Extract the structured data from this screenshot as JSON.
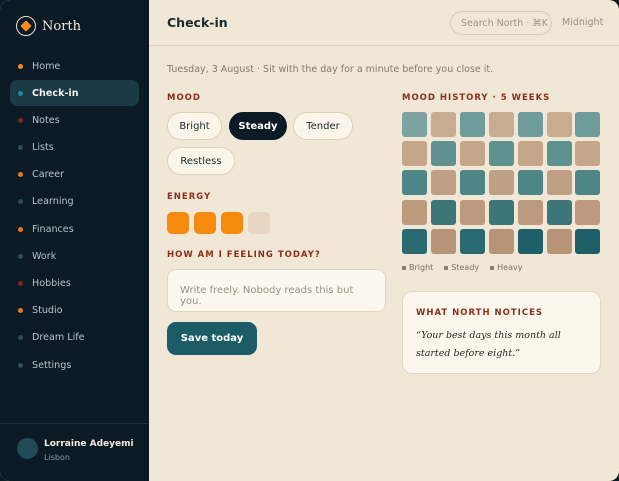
{
  "brand": {
    "name": "North",
    "accent": "#f58a1f"
  },
  "nav": [
    {
      "label": "Home",
      "dot": "#f58a1f"
    },
    {
      "label": "Check-in",
      "dot": "#1c8a98"
    },
    {
      "label": "Notes",
      "dot": "#7a2b20"
    },
    {
      "label": "Lists",
      "dot": "#2b4f5a"
    },
    {
      "label": "Career",
      "dot": "#e07a20"
    },
    {
      "label": "Learning",
      "dot": "#2b4f5a"
    },
    {
      "label": "Finances",
      "dot": "#e07a20"
    },
    {
      "label": "Work",
      "dot": "#2b4f5a"
    },
    {
      "label": "Hobbies",
      "dot": "#7a2b20"
    },
    {
      "label": "Studio",
      "dot": "#e07a20"
    },
    {
      "label": "Dream Life",
      "dot": "#2b4f5a"
    },
    {
      "label": "Settings",
      "dot": "#2b4f5a"
    }
  ],
  "active_nav": "Check-in",
  "user": {
    "name": "Lorraine Adeyemi",
    "location": "Lisbon"
  },
  "header": {
    "title": "Check-in",
    "search_placeholder": "Search North · ⌘K",
    "theme": "Midnight"
  },
  "date_line": "Tuesday, 3 August · Sit with the day for a minute before you close it.",
  "mood": {
    "label": "MOOD",
    "options": [
      "Bright",
      "Steady",
      "Tender",
      "Restless"
    ],
    "selected": "Steady"
  },
  "energy": {
    "label": "ENERGY",
    "level": 3,
    "max": 4,
    "on_color": "#f58a0c",
    "off_color": "#e6d6c2"
  },
  "feeling": {
    "label": "HOW AM I FEELING TODAY?",
    "placeholder": "Write freely. Nobody reads this but you."
  },
  "save_label": "Save today",
  "history": {
    "label": "MOOD HISTORY · 5 WEEKS",
    "rows": [
      [
        "#7ca3a0",
        "#c8ab91",
        "#6f9b9a",
        "#c8ab91",
        "#6f9b9a",
        "#c8ab91",
        "#6f9b9a"
      ],
      [
        "#c5a68b",
        "#5f9191",
        "#c5a68b",
        "#5f9191",
        "#c5a68b",
        "#5f9191",
        "#c5a68b"
      ],
      [
        "#4e8587",
        "#c0a085",
        "#4e8587",
        "#c0a085",
        "#4e8587",
        "#c0a085",
        "#4e8587"
      ],
      [
        "#bc9a7e",
        "#3c7679",
        "#bc9a7e",
        "#3c7679",
        "#bc9a7e",
        "#3c7679",
        "#bc9a7e"
      ],
      [
        "#2a6a70",
        "#b69478",
        "#2a6a70",
        "#b69478",
        "#1f6068",
        "#b69478",
        "#1f6068"
      ]
    ],
    "legend": [
      "Bright",
      "Steady",
      "Heavy"
    ]
  },
  "notice": {
    "title": "WHAT NORTH NOTICES",
    "quote": "“Your best days this month all started before eight.”"
  }
}
